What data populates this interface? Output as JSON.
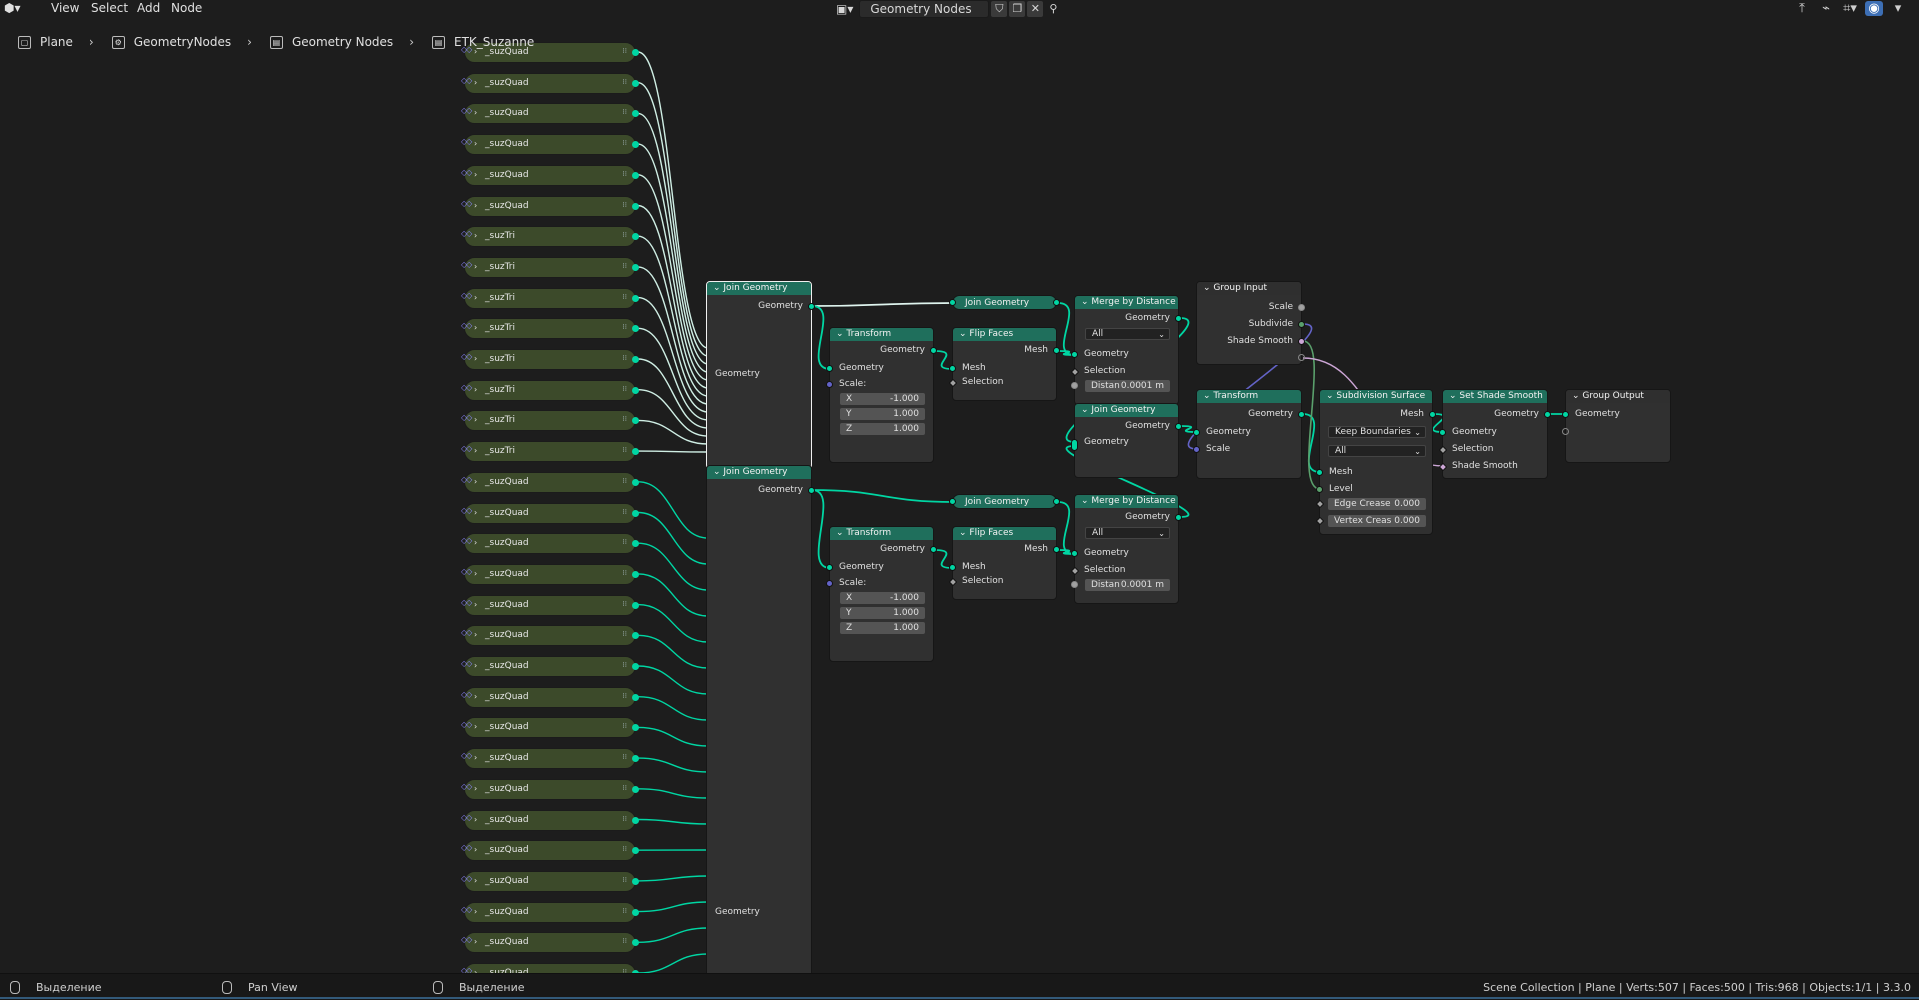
{
  "menu": {
    "view": "View",
    "select": "Select",
    "add": "Add",
    "node": "Node"
  },
  "node_tree": {
    "name": "Geometry Nodes"
  },
  "breadcrumb": [
    "Plane",
    "GeometryNodes",
    "Geometry Nodes",
    "ETK_Suzanne"
  ],
  "instance_nodes": [
    "_suzQuad",
    "_suzQuad",
    "_suzQuad",
    "_suzQuad",
    "_suzQuad",
    "_suzQuad",
    "_suzTri",
    "_suzTri",
    "_suzTri",
    "_suzTri",
    "_suzTri",
    "_suzTri",
    "_suzTri",
    "_suzTri",
    "_suzQuad",
    "_suzQuad",
    "_suzQuad",
    "_suzQuad",
    "_suzQuad",
    "_suzQuad",
    "_suzQuad",
    "_suzQuad",
    "_suzQuad",
    "_suzQuad",
    "_suzQuad",
    "_suzQuad",
    "_suzQuad",
    "_suzQuad",
    "_suzQuad",
    "_suzQuad",
    "_suzQuad"
  ],
  "nodes": {
    "join1": {
      "title": "Join Geometry",
      "out": "Geometry",
      "in": "Geometry"
    },
    "join2": {
      "title": "Join Geometry",
      "out": "Geometry",
      "in": "Geometry"
    },
    "transform1": {
      "title": "Transform",
      "out": "Geometry",
      "in": "Geometry",
      "scale": "Scale:",
      "x": "-1.000",
      "y": "1.000",
      "z": "1.000"
    },
    "transform2": {
      "title": "Transform",
      "out": "Geometry",
      "in": "Geometry",
      "scale": "Scale:",
      "x": "-1.000",
      "y": "1.000",
      "z": "1.000"
    },
    "flip1": {
      "title": "Flip Faces",
      "out": "Mesh",
      "in_mesh": "Mesh",
      "in_sel": "Selection"
    },
    "flip2": {
      "title": "Flip Faces",
      "out": "Mesh",
      "in_mesh": "Mesh",
      "in_sel": "Selection"
    },
    "join_c1": {
      "title": "Join Geometry"
    },
    "join_c2": {
      "title": "Join Geometry"
    },
    "merge1": {
      "title": "Merge by Distance",
      "out": "Geometry",
      "mode": "All",
      "in_geo": "Geometry",
      "in_sel": "Selection",
      "dist_label": "Distan",
      "dist_value": "0.0001 m"
    },
    "merge2": {
      "title": "Merge by Distance",
      "out": "Geometry",
      "mode": "All",
      "in_geo": "Geometry",
      "in_sel": "Selection",
      "dist_label": "Distan",
      "dist_value": "0.0001 m"
    },
    "join3": {
      "title": "Join Geometry",
      "out": "Geometry",
      "in": "Geometry"
    },
    "group_input": {
      "title": "Group Input",
      "scale": "Scale",
      "subdivide": "Subdivide",
      "shade_smooth": "Shade Smooth"
    },
    "transform3": {
      "title": "Transform",
      "out": "Geometry",
      "in_geo": "Geometry",
      "in_scale": "Scale"
    },
    "subsurf": {
      "title": "Subdivision Surface",
      "out": "Mesh",
      "boundary": "Keep Boundaries",
      "uv": "All",
      "in_mesh": "Mesh",
      "in_level": "Level",
      "edge_label": "Edge Crease",
      "edge_value": "0.000",
      "vert_label": "Vertex Creas",
      "vert_value": "0.000"
    },
    "shade": {
      "title": "Set Shade Smooth",
      "out": "Geometry",
      "in_geo": "Geometry",
      "in_sel": "Selection",
      "in_ss": "Shade Smooth"
    },
    "group_output": {
      "title": "Group Output",
      "in": "Geometry"
    }
  },
  "status": {
    "left1": "Выделение",
    "left2": "Pan View",
    "left3": "Выделение",
    "right": "Scene Collection | Plane | Verts:507 | Faces:500 | Tris:968 | Objects:1/1 | 3.3.0"
  },
  "colors": {
    "geometry_socket": "#00d6a3",
    "node_header": "#1f6f5c",
    "instance_node": "#3c4a2a",
    "vector_socket": "#6363c7"
  }
}
